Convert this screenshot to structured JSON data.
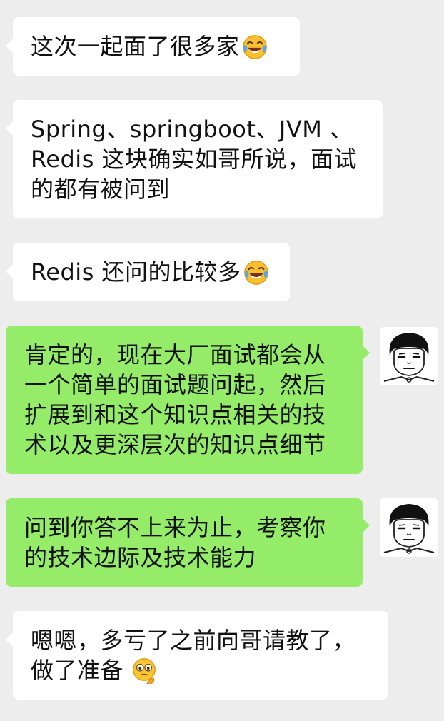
{
  "messages": [
    {
      "side": "left",
      "text": "这次一起面了很多家",
      "emoji": "laugh-cry-emoji"
    },
    {
      "side": "left",
      "text": "Spring、springboot、JVM 、\nRedis 这块确实如哥所说，面试\n的都有被问到"
    },
    {
      "side": "left",
      "text": "Redis 还问的比较多",
      "emoji": "laugh-cry-emoji"
    },
    {
      "side": "right",
      "text": "肯定的，现在大厂面试都会从\n一个简单的面试题问起，然后\n扩展到和这个知识点相关的技\n术以及更深层次的知识点细节"
    },
    {
      "side": "right",
      "text": "问到你答不上来为止，考察你\n的技术边际及技术能力"
    },
    {
      "side": "left",
      "text": "嗯嗯，多亏了之前向哥请教了，\n做了准备",
      "emoji": "thinking-emoji"
    }
  ],
  "colors": {
    "background": "#ededed",
    "incoming_bubble": "#ffffff",
    "outgoing_bubble": "#95ec69"
  },
  "avatar_icon": "cartoon-face-avatar"
}
